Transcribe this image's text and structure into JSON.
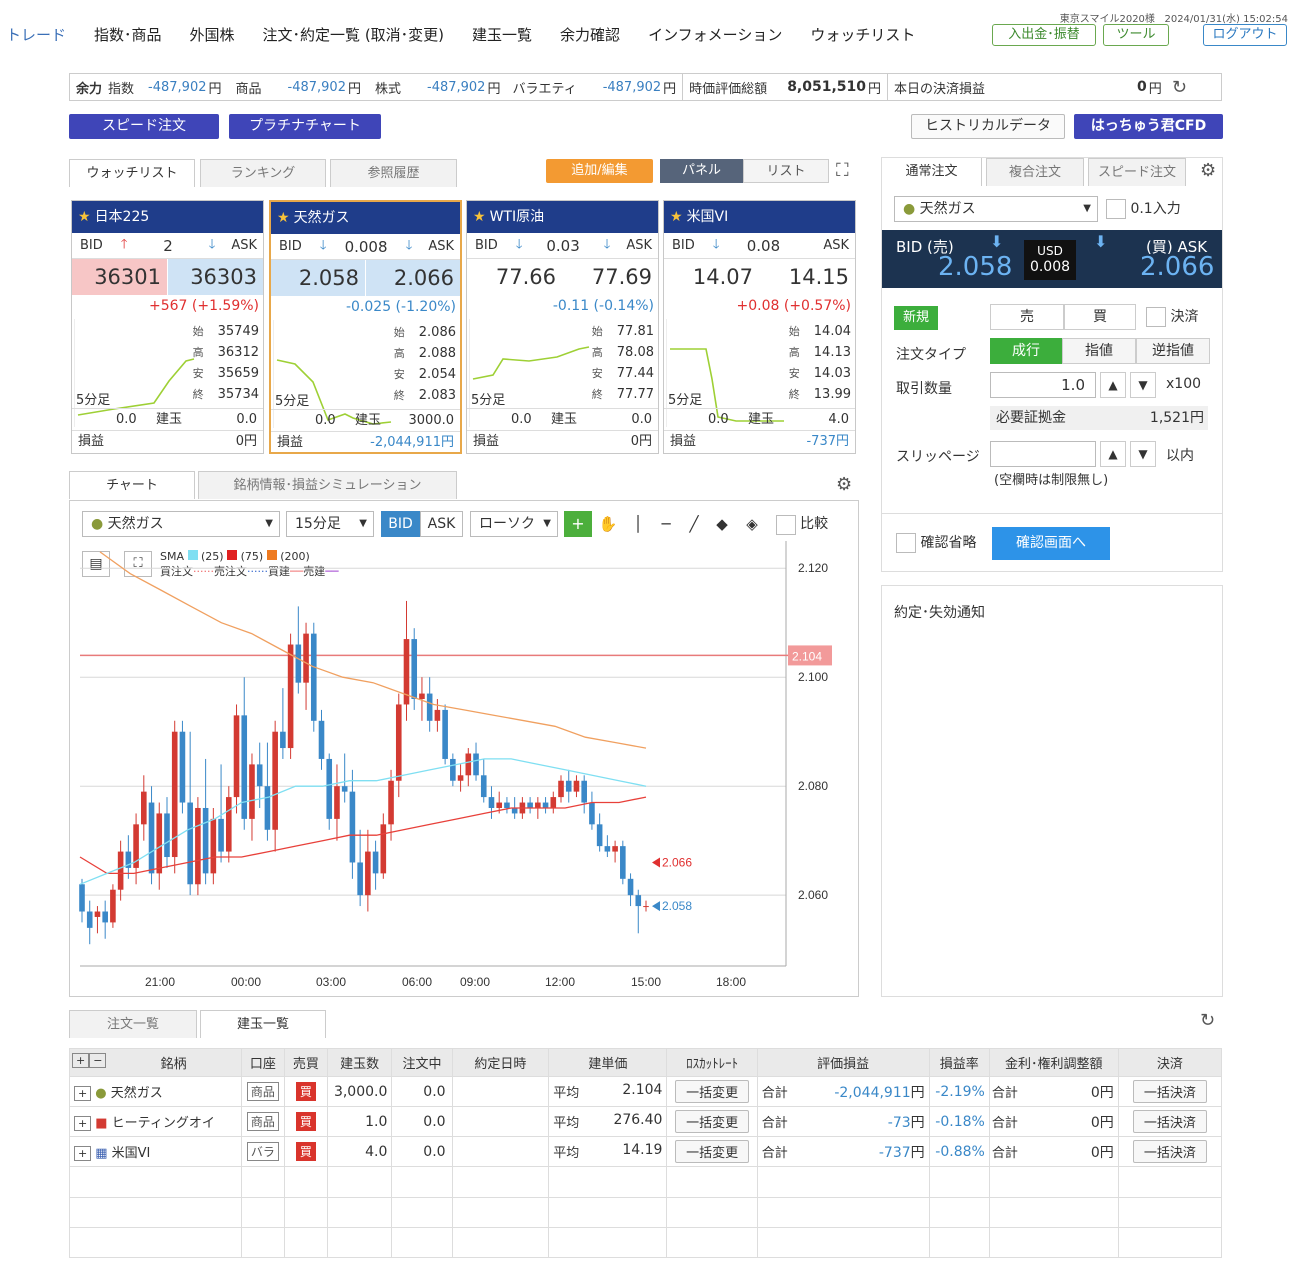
{
  "header": {
    "user": "東京スマイル2020様",
    "datetime": "2024/01/31(水) 15:02:54",
    "nav": [
      "トレード",
      "指数･商品",
      "外国株",
      "注文･約定一覧 (取消･変更)",
      "建玉一覧",
      "余力確認",
      "インフォメーション",
      "ウォッチリスト"
    ],
    "deposit": "入出金･振替",
    "tool": "ツール",
    "logout": "ログアウト"
  },
  "balance": {
    "label": "余力",
    "index_label": "指数",
    "index_val": "-487,902",
    "commodity_label": "商品",
    "commodity_val": "-487,902",
    "stock_label": "株式",
    "stock_val": "-487,902",
    "variety_label": "バラエティ",
    "variety_val": "-487,902",
    "yen": "円",
    "mv_label": "時価評価総額",
    "mv_val": "8,051,510",
    "today_label": "本日の決済損益",
    "today_val": "0"
  },
  "buttons": {
    "speed": "スピード注文",
    "platinum": "プラチナチャート",
    "historical": "ヒストリカルデータ",
    "cfd": "はっちゅう君CFD"
  },
  "watch_tabs": [
    "ウォッチリスト",
    "ランキング",
    "参照履歴"
  ],
  "watch_ctrl": {
    "add": "追加/編集",
    "panel": "パネル",
    "list": "リスト"
  },
  "panels": [
    {
      "name": "日本225",
      "spread": "2",
      "bid": "36301",
      "ask": "36303",
      "chg": "+567 (+1.59%)",
      "dir": "up",
      "o": "35749",
      "h": "36312",
      "l": "35659",
      "c": "35734",
      "pos_l": "0.0",
      "pos_r": "0.0",
      "pl": "0円",
      "pl_dir": "flat"
    },
    {
      "name": "天然ガス",
      "spread": "0.008",
      "bid": "2.058",
      "ask": "2.066",
      "chg": "-0.025 (-1.20%)",
      "dir": "down",
      "o": "2.086",
      "h": "2.088",
      "l": "2.054",
      "c": "2.083",
      "pos_l": "0.0",
      "pos_r": "3000.0",
      "pl": "-2,044,911円",
      "pl_dir": "down"
    },
    {
      "name": "WTI原油",
      "spread": "0.03",
      "bid": "77.66",
      "ask": "77.69",
      "chg": "-0.11 (-0.14%)",
      "dir": "down",
      "o": "77.81",
      "h": "78.08",
      "l": "77.44",
      "c": "77.77",
      "pos_l": "0.0",
      "pos_r": "0.0",
      "pl": "0円",
      "pl_dir": "flat"
    },
    {
      "name": "米国VI",
      "spread": "0.08",
      "bid": "14.07",
      "ask": "14.15",
      "chg": "+0.08 (+0.57%)",
      "dir": "up",
      "o": "14.04",
      "h": "14.13",
      "l": "14.03",
      "c": "13.99",
      "pos_l": "0.0",
      "pos_r": "4.0",
      "pl": "-737円",
      "pl_dir": "down"
    }
  ],
  "panel_labels": {
    "bid": "BID",
    "ask": "ASK",
    "open": "始",
    "high": "高",
    "low": "安",
    "close": "終",
    "period": "5分足",
    "position": "建玉",
    "pl": "損益"
  },
  "chart_tabs": [
    "チャート",
    "銘柄情報･損益シミュレーション"
  ],
  "chart_toolbar": {
    "symbol": "天然ガス",
    "interval": "15分足",
    "bid": "BID",
    "ask": "ASK",
    "type": "ローソク",
    "compare": "比較"
  },
  "chart_legend": {
    "sma": "SMA",
    "p1": "(25)",
    "p2": "(75)",
    "p3": "(200)",
    "buy_order": "買注文",
    "sell_order": "売注文",
    "buy_pos": "買建",
    "sell_pos": "売建"
  },
  "chart_data": {
    "type": "candlestick",
    "x_ticks": [
      "21:00",
      "00:00",
      "03:00",
      "06:00",
      "09:00",
      "12:00",
      "15:00",
      "18:00"
    ],
    "y_ticks": [
      "2.120",
      "2.100",
      "2.080",
      "2.060"
    ],
    "ylim": [
      2.047,
      2.125
    ],
    "position_line": "2.104",
    "ask_marker": "2.066",
    "bid_marker": "2.058",
    "candles": [
      [
        2.062,
        2.063,
        2.055,
        2.057
      ],
      [
        2.057,
        2.059,
        2.051,
        2.054
      ],
      [
        2.056,
        2.058,
        2.053,
        2.057
      ],
      [
        2.057,
        2.059,
        2.052,
        2.055
      ],
      [
        2.055,
        2.062,
        2.054,
        2.061
      ],
      [
        2.061,
        2.07,
        2.059,
        2.068
      ],
      [
        2.068,
        2.071,
        2.063,
        2.065
      ],
      [
        2.065,
        2.075,
        2.062,
        2.073
      ],
      [
        2.073,
        2.082,
        2.07,
        2.079
      ],
      [
        2.077,
        2.08,
        2.062,
        2.064
      ],
      [
        2.064,
        2.077,
        2.061,
        2.075
      ],
      [
        2.075,
        2.078,
        2.065,
        2.067
      ],
      [
        2.067,
        2.092,
        2.064,
        2.09
      ],
      [
        2.09,
        2.092,
        2.075,
        2.077
      ],
      [
        2.077,
        2.09,
        2.06,
        2.062
      ],
      [
        2.062,
        2.078,
        2.06,
        2.076
      ],
      [
        2.076,
        2.085,
        2.062,
        2.064
      ],
      [
        2.064,
        2.076,
        2.062,
        2.074
      ],
      [
        2.074,
        2.084,
        2.066,
        2.068
      ],
      [
        2.068,
        2.08,
        2.066,
        2.078
      ],
      [
        2.078,
        2.095,
        2.075,
        2.093
      ],
      [
        2.093,
        2.1,
        2.072,
        2.074
      ],
      [
        2.074,
        2.086,
        2.07,
        2.084
      ],
      [
        2.084,
        2.088,
        2.076,
        2.08
      ],
      [
        2.08,
        2.088,
        2.07,
        2.072
      ],
      [
        2.072,
        2.092,
        2.068,
        2.09
      ],
      [
        2.09,
        2.098,
        2.085,
        2.087
      ],
      [
        2.087,
        2.108,
        2.085,
        2.106
      ],
      [
        2.106,
        2.113,
        2.097,
        2.099
      ],
      [
        2.099,
        2.11,
        2.094,
        2.108
      ],
      [
        2.108,
        2.11,
        2.09,
        2.092
      ],
      [
        2.092,
        2.094,
        2.083,
        2.085
      ],
      [
        2.085,
        2.086,
        2.072,
        2.074
      ],
      [
        2.074,
        2.084,
        2.07,
        2.08
      ],
      [
        2.08,
        2.086,
        2.077,
        2.079
      ],
      [
        2.079,
        2.083,
        2.063,
        2.066
      ],
      [
        2.066,
        2.072,
        2.058,
        2.06
      ],
      [
        2.06,
        2.072,
        2.057,
        2.068
      ],
      [
        2.068,
        2.07,
        2.061,
        2.064
      ],
      [
        2.064,
        2.075,
        2.063,
        2.073
      ],
      [
        2.073,
        2.083,
        2.07,
        2.081
      ],
      [
        2.081,
        2.097,
        2.078,
        2.095
      ],
      [
        2.095,
        2.114,
        2.092,
        2.107
      ],
      [
        2.107,
        2.109,
        2.094,
        2.096
      ],
      [
        2.096,
        2.1,
        2.092,
        2.097
      ],
      [
        2.097,
        2.1,
        2.09,
        2.092
      ],
      [
        2.092,
        2.096,
        2.09,
        2.094
      ],
      [
        2.094,
        2.095,
        2.084,
        2.085
      ],
      [
        2.085,
        2.086,
        2.08,
        2.081
      ],
      [
        2.081,
        2.084,
        2.079,
        2.082
      ],
      [
        2.082,
        2.087,
        2.08,
        2.086
      ],
      [
        2.086,
        2.088,
        2.081,
        2.082
      ],
      [
        2.082,
        2.085,
        2.077,
        2.078
      ],
      [
        2.078,
        2.08,
        2.074,
        2.076
      ],
      [
        2.076,
        2.079,
        2.075,
        2.077
      ],
      [
        2.077,
        2.078,
        2.075,
        2.076
      ],
      [
        2.076,
        2.078,
        2.074,
        2.075
      ],
      [
        2.075,
        2.078,
        2.074,
        2.077
      ],
      [
        2.077,
        2.078,
        2.075,
        2.076
      ],
      [
        2.076,
        2.078,
        2.074,
        2.077
      ],
      [
        2.077,
        2.078,
        2.075,
        2.076
      ],
      [
        2.076,
        2.079,
        2.075,
        2.078
      ],
      [
        2.078,
        2.082,
        2.077,
        2.081
      ],
      [
        2.081,
        2.083,
        2.077,
        2.079
      ],
      [
        2.079,
        2.082,
        2.078,
        2.081
      ],
      [
        2.081,
        2.082,
        2.075,
        2.077
      ],
      [
        2.077,
        2.079,
        2.072,
        2.073
      ],
      [
        2.073,
        2.075,
        2.068,
        2.069
      ],
      [
        2.069,
        2.071,
        2.067,
        2.068
      ],
      [
        2.068,
        2.07,
        2.066,
        2.069
      ],
      [
        2.069,
        2.07,
        2.062,
        2.063
      ],
      [
        2.063,
        2.064,
        2.058,
        2.06
      ],
      [
        2.06,
        2.061,
        2.053,
        2.058
      ],
      [
        2.058,
        2.059,
        2.057,
        2.058
      ]
    ],
    "sma25": [
      2.062,
      2.064,
      2.066,
      2.069,
      2.072,
      2.074,
      2.077,
      2.078,
      2.08,
      2.08,
      2.081,
      2.081,
      2.082,
      2.083,
      2.084,
      2.085,
      2.085,
      2.084,
      2.083,
      2.082,
      2.081,
      2.08
    ],
    "sma75": [
      2.067,
      2.064,
      2.064,
      2.065,
      2.066,
      2.067,
      2.067,
      2.068,
      2.069,
      2.07,
      2.071,
      2.071,
      2.072,
      2.073,
      2.074,
      2.075,
      2.076,
      2.076,
      2.076,
      2.077,
      2.077,
      2.078
    ],
    "sma200": [
      2.123,
      2.119,
      2.116,
      2.113,
      2.11,
      2.108,
      2.105,
      2.102,
      2.1,
      2.099,
      2.097,
      2.095,
      2.094,
      2.093,
      2.092,
      2.091,
      2.089,
      2.088,
      2.087
    ]
  },
  "order_tabs": [
    "通常注文",
    "複合注文",
    "スピード注文"
  ],
  "order": {
    "symbol": "天然ガス",
    "lot01": "0.1入力",
    "bid_label": "BID (売)",
    "ask_label": "(買) ASK",
    "bid": "2.058",
    "ask": "2.066",
    "ccy": "USD",
    "spread": "0.008",
    "new": "新規",
    "sell": "売",
    "buy": "買",
    "settle": "決済",
    "type_label": "注文タイプ",
    "market": "成行",
    "limit": "指値",
    "stop": "逆指値",
    "qty_label": "取引数量",
    "qty": "1.0",
    "unit": "x100",
    "margin_label": "必要証拠金",
    "margin": "1,521円",
    "slip_label": "スリッページ",
    "slip_unit": "以内",
    "slip_note": "(空欄時は制限無し)",
    "skip_confirm": "確認省略",
    "confirm": "確認画面へ"
  },
  "notify": {
    "title": "約定･失効通知"
  },
  "position_tabs": [
    "注文一覧",
    "建玉一覧"
  ],
  "table": {
    "headers": [
      "銘柄",
      "口座",
      "売買",
      "建玉数",
      "注文中",
      "約定日時",
      "建単価",
      "ﾛｽｶｯﾄﾚｰﾄ",
      "評価損益",
      "損益率",
      "金利･権利調整額",
      "決済"
    ],
    "rows": [
      {
        "name": "天然ガス",
        "acct": "商品",
        "side": "買",
        "qty": "3,000.0",
        "pending": "0.0",
        "avg_l": "平均",
        "avg": "2.104",
        "lc": "一括変更",
        "sum": "合計",
        "pl": "-2,044,911",
        "yen": "円",
        "rate": "-2.19%",
        "adj_l": "合計",
        "adj": "0",
        "settle": "一括決済"
      },
      {
        "name": "ヒーティングオイ",
        "acct": "商品",
        "side": "買",
        "qty": "1.0",
        "pending": "0.0",
        "avg_l": "平均",
        "avg": "276.40",
        "lc": "一括変更",
        "sum": "合計",
        "pl": "-73",
        "yen": "円",
        "rate": "-0.18%",
        "adj_l": "合計",
        "adj": "0",
        "settle": "一括決済"
      },
      {
        "name": "米国VI",
        "acct": "バラ",
        "side": "買",
        "qty": "4.0",
        "pending": "0.0",
        "avg_l": "平均",
        "avg": "14.19",
        "lc": "一括変更",
        "sum": "合計",
        "pl": "-737",
        "yen": "円",
        "rate": "-0.88%",
        "adj_l": "合計",
        "adj": "0",
        "settle": "一括決済"
      }
    ]
  },
  "colors": {
    "accent": "#3f45b8",
    "panel_head": "#1f3d8a",
    "up": "#e03030",
    "down": "#3a88c8",
    "orange": "#f0962e",
    "green": "#3cae3c"
  }
}
